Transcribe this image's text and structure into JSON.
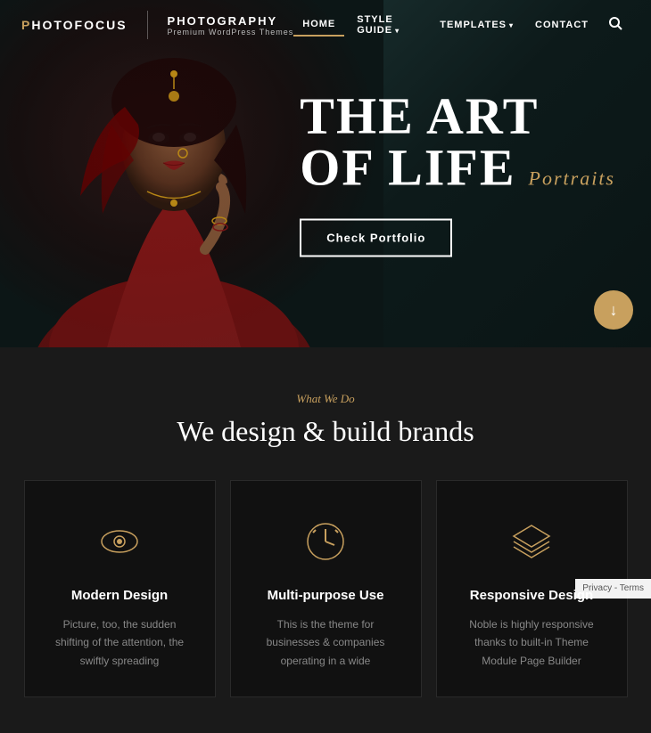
{
  "header": {
    "logo_letter": "P",
    "logo_brand": "hotoFocus",
    "logo_divider_text": "PHOTOGRAPHY",
    "logo_sub": "Premium WordPress Themes",
    "nav": {
      "items": [
        {
          "label": "HOME",
          "active": true,
          "has_dropdown": false
        },
        {
          "label": "STYLE GUIDE",
          "active": false,
          "has_dropdown": true
        },
        {
          "label": "TEMPLATES",
          "active": false,
          "has_dropdown": true
        },
        {
          "label": "CONTACT",
          "active": false,
          "has_dropdown": false
        }
      ],
      "search_icon": "🔍"
    }
  },
  "hero": {
    "title_line1": "THE ART",
    "title_line2": "OF LIFE",
    "subtitle": "Portraits",
    "cta_label": "Check Portfolio",
    "scroll_icon": "↓"
  },
  "what_we_do": {
    "tag": "What We Do",
    "title": "We design & build brands",
    "cards": [
      {
        "icon": "eye",
        "title": "Modern Design",
        "text": "Picture, too, the sudden shifting of the attention, the swiftly spreading"
      },
      {
        "icon": "clock",
        "title": "Multi-purpose Use",
        "text": "This is the theme for businesses & companies operating in a wide"
      },
      {
        "icon": "layers",
        "title": "Responsive Design",
        "text": "Noble is highly responsive thanks to built-in Theme Module Page Builder"
      }
    ]
  },
  "privacy": {
    "text": "Privacy - Terms"
  }
}
